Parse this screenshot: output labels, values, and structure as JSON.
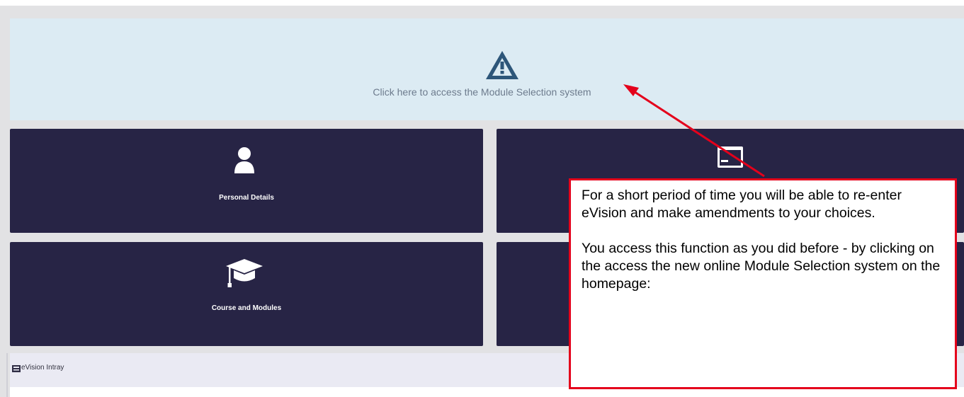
{
  "banner": {
    "icon": "warning-triangle-icon",
    "link_text": "Click here to access the Module Selection system"
  },
  "tiles": [
    {
      "label": "Personal Details",
      "icon": "user-icon"
    },
    {
      "label": "",
      "icon": "card-icon"
    },
    {
      "label": "Course and Modules",
      "icon": "graduation-cap-icon"
    },
    {
      "label": "",
      "icon": ""
    }
  ],
  "intray": {
    "icon": "inbox-icon",
    "title": "eVision Intray"
  },
  "callout": {
    "text": "For a short period of time you will be able to re-enter eVision and make amendments to your choices.\n\nYou access this function as you did before - by clicking on the access the new online Module Selection system on the homepage:"
  },
  "colors": {
    "tile_bg": "#272445",
    "banner_bg": "#dcebf3",
    "callout_border": "#e4001b",
    "arrow": "#e4001b"
  }
}
